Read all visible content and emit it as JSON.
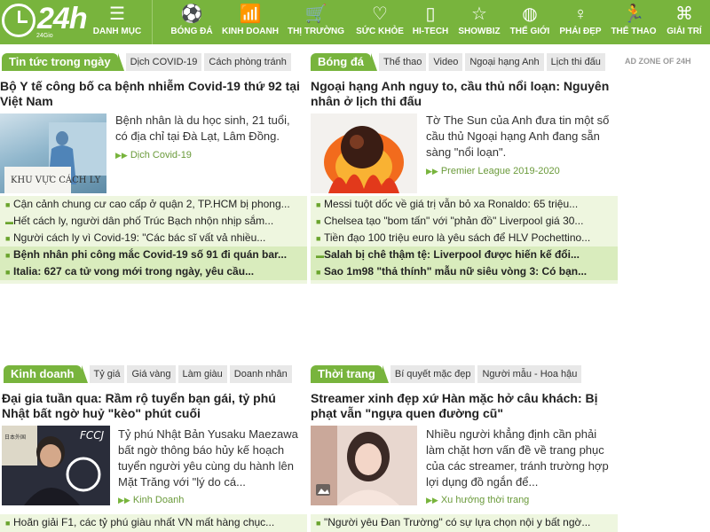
{
  "nav": {
    "logo_text": "24h",
    "logo_sub": "24Gio",
    "items": [
      {
        "label": "DANH MỤC",
        "icon": "menu-icon",
        "glyph": "☰"
      },
      {
        "label": "BÓNG ĐÁ",
        "icon": "soccer-ball-icon",
        "glyph": "⚽"
      },
      {
        "label": "KINH DOANH",
        "icon": "bar-chart-icon",
        "glyph": "📶"
      },
      {
        "label": "THỊ TRƯỜNG",
        "icon": "shopping-cart-icon",
        "glyph": "🛒"
      },
      {
        "label": "SỨC KHỎE",
        "icon": "heart-pulse-icon",
        "glyph": "♡"
      },
      {
        "label": "HI-TECH",
        "icon": "devices-icon",
        "glyph": "▯"
      },
      {
        "label": "SHOWBIZ",
        "icon": "star-icon",
        "glyph": "☆"
      },
      {
        "label": "THẾ GIỚI",
        "icon": "globe-icon",
        "glyph": "◍"
      },
      {
        "label": "PHÁI ĐẸP",
        "icon": "woman-icon",
        "glyph": "♀"
      },
      {
        "label": "THỂ THAO",
        "icon": "runner-icon",
        "glyph": "🏃"
      },
      {
        "label": "GIẢI TRÍ",
        "icon": "mask-icon",
        "glyph": "⌘"
      }
    ]
  },
  "ad_zone": "AD ZONE OF 24H",
  "sections": [
    {
      "title": "Tin tức trong ngày",
      "tabs": [
        "Dịch COVID-19",
        "Cách phòng tránh"
      ],
      "headline": "Bộ Y tế công bố ca bệnh nhiễm Covid-19 thứ 92 tại Việt Nam",
      "summary": "Bệnh nhân là du học sinh, 21 tuổi, có địa chỉ tại Đà Lạt, Lâm Đồng.",
      "category": "Dịch Covid-19",
      "image_sign": "KHU VỰC CÁCH LY",
      "list": [
        {
          "text": "Cận cảnh chung cư cao cấp ở quận 2, TP.HCM bị phong...",
          "icon": "bullet",
          "bold": false
        },
        {
          "text": "Hết cách ly, người dân phố Trúc Bạch nhộn nhịp sắm...",
          "icon": "video",
          "bold": false
        },
        {
          "text": "Người cách ly vì Covid-19: \"Các bác sĩ vất vả nhiều...",
          "icon": "bullet",
          "bold": false
        },
        {
          "text": "Bệnh nhân phi công mắc Covid-19 số 91 đi quán bar...",
          "icon": "bullet",
          "bold": true
        },
        {
          "text": "Italia: 627 ca tử vong mới trong ngày, yêu cầu...",
          "icon": "bullet",
          "bold": true
        }
      ]
    },
    {
      "title": "Bóng đá",
      "tabs": [
        "Thể thao",
        "Video",
        "Ngoại hạng Anh",
        "Lịch thi đấu"
      ],
      "headline": "Ngoại hạng Anh nguy to, cầu thủ nổi loạn: Nguyên nhân ở lịch thi đấu",
      "summary": "Tờ The Sun của Anh đưa tin một số cầu thủ Ngoại hạng Anh đang sẵn sàng \"nổi loạn\".",
      "category": "Premier League 2019-2020",
      "list": [
        {
          "text": "Messi tuột dốc về giá trị vẫn bỏ xa Ronaldo: 65 triệu...",
          "icon": "bullet",
          "bold": false
        },
        {
          "text": "Chelsea tạo \"bom tấn\" với \"phản đồ\" Liverpool giá 30...",
          "icon": "bullet",
          "bold": false
        },
        {
          "text": "Tiền đạo 100 triệu euro là yêu sách để HLV Pochettino...",
          "icon": "bullet",
          "bold": false
        },
        {
          "text": "Salah bị chê thậm tệ: Liverpool được hiến kế đổi...",
          "icon": "video",
          "bold": true
        },
        {
          "text": "Sao 1m98 \"thả thính\" mẫu nữ siêu vòng 3: Có bạn...",
          "icon": "bullet",
          "bold": true
        }
      ]
    },
    {
      "title": "Kinh doanh",
      "tabs": [
        "Tỷ giá",
        "Giá vàng",
        "Làm giàu",
        "Doanh nhân"
      ],
      "headline": "Đại gia tuần qua: Rầm rộ tuyển bạn gái, tỷ phú Nhật bất ngờ huỷ \"kèo\" phút cuối",
      "summary": "Tỷ phú Nhật Bản Yusaku Maezawa bất ngờ thông báo hủy kế hoạch tuyển người yêu cùng du hành lên Mặt Trăng với \"lý do cá...",
      "category": "Kinh Doanh",
      "image_sign": "FCCJ",
      "list": [
        {
          "text": "Hoãn giải F1, các tỷ phú giàu nhất VN mất hàng chục...",
          "icon": "bullet",
          "bold": false
        }
      ]
    },
    {
      "title": "Thời trang",
      "tabs": [
        "Bí quyết mặc đẹp",
        "Người mẫu - Hoa hậu"
      ],
      "headline": "Streamer xinh đẹp xứ Hàn mặc hở câu khách: Bị phạt vẫn \"ngựa quen đường cũ\"",
      "summary": "Nhiều người khẳng định cần phải làm chặt hơn vấn đề về trang phục của các streamer, tránh trường hợp lợi dụng đồ ngắn để...",
      "category": "Xu hướng thời trang",
      "list": [
        {
          "text": "\"Người yêu Đan Trường\" có sự lựa chọn nội y bất ngờ...",
          "icon": "bullet",
          "bold": false
        }
      ]
    }
  ]
}
